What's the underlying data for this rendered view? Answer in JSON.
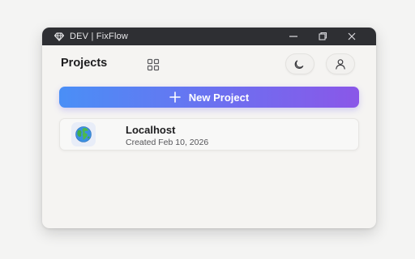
{
  "window": {
    "title": "DEV | FixFlow"
  },
  "header": {
    "title": "Projects"
  },
  "actions": {
    "new_project_label": "New Project"
  },
  "projects": [
    {
      "name": "Localhost",
      "created": "Created Feb 10, 2026",
      "icon": "globe-icon"
    }
  ],
  "icons": {
    "app": "diamond-icon",
    "minimize": "minimize-icon",
    "maximize": "maximize-icon",
    "close": "close-icon",
    "grid": "grid-icon",
    "theme": "moon-icon",
    "user": "user-icon",
    "add": "plus-icon"
  },
  "colors": {
    "titlebar": "#2e2f33",
    "button_gradient_start": "#4a8ff6",
    "button_gradient_end": "#8a57e8",
    "background": "#f5f4f2"
  }
}
